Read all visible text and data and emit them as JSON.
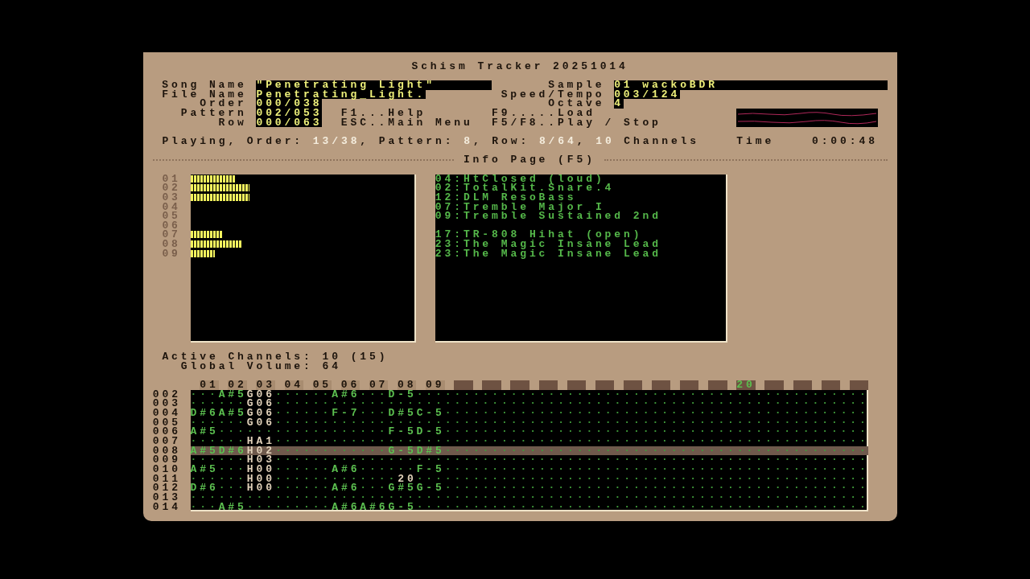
{
  "title": "Schism Tracker 20251014",
  "song_fields": [
    {
      "label": "Song Name",
      "value": "\"Penetrating Light\""
    },
    {
      "label": "File Name",
      "value": "Penetrating_Light."
    },
    {
      "label": "Order",
      "value": "000/038"
    },
    {
      "label": "Pattern",
      "value": "002/053"
    },
    {
      "label": "Row",
      "value": "000/063"
    }
  ],
  "shortcuts": [
    {
      "text": "F1...Help"
    },
    {
      "text": "ESC..Main Menu"
    },
    {
      "text": "F9.....Load"
    },
    {
      "text": "F5/F8..Play / Stop"
    }
  ],
  "sample_fields": [
    {
      "label": "Sample",
      "value": "01 wackoBDR"
    },
    {
      "label": "Speed/Tempo",
      "value": "003/124"
    },
    {
      "label": "Octave",
      "value": "4"
    }
  ],
  "status": [
    {
      "text": "Playing, Order: ",
      "kind": "label"
    },
    {
      "text": "13/38",
      "kind": "value"
    },
    {
      "text": ", Pattern: ",
      "kind": "label"
    },
    {
      "text": "8",
      "kind": "value"
    },
    {
      "text": ", Row: ",
      "kind": "label"
    },
    {
      "text": "8/64",
      "kind": "value"
    },
    {
      "text": ", ",
      "kind": "label"
    },
    {
      "text": "10",
      "kind": "value"
    },
    {
      "text": " Channels",
      "kind": "label"
    }
  ],
  "time": {
    "label": "Time",
    "value": "0:00:48"
  },
  "page_title": "Info Page (F5)",
  "channels": [
    {
      "number": "01",
      "level": 0.2,
      "instrument": "04:HtClosed (loud)"
    },
    {
      "number": "02",
      "level": 0.26,
      "instrument": "02:TotalKit.Snare.4"
    },
    {
      "number": "03",
      "level": 0.26,
      "instrument": "12:DLM ResoBass"
    },
    {
      "number": "04",
      "level": 0,
      "instrument": "07:Tremble Major I"
    },
    {
      "number": "05",
      "level": 0,
      "instrument": "09:Tremble Sustained 2nd"
    },
    {
      "number": "06",
      "level": 0
    },
    {
      "number": "07",
      "level": 0.14,
      "instrument": "17:TR-808 Hihat (open)"
    },
    {
      "number": "08",
      "level": 0.23,
      "instrument": "23:The Magic Insane Lead"
    },
    {
      "number": "09",
      "level": 0.11,
      "instrument": "23:The Magic Insane Lead"
    }
  ],
  "active_channels": "Active Channels: 10 (15)",
  "global_volume": "Global Volume: 64",
  "pattern": {
    "headers": [
      {
        "label": "01",
        "kind": "plain"
      },
      {
        "label": "02",
        "kind": "plain"
      },
      {
        "label": "03",
        "kind": "plain"
      },
      {
        "label": "04",
        "kind": "plain"
      },
      {
        "label": "05",
        "kind": "plain"
      },
      {
        "label": "06",
        "kind": "plain"
      },
      {
        "label": "07",
        "kind": "plain"
      },
      {
        "label": "08",
        "kind": "plain"
      },
      {
        "label": "09",
        "kind": "plain"
      },
      {
        "kind": "blank"
      },
      {
        "kind": "blank"
      },
      {
        "kind": "blank"
      },
      {
        "kind": "blank"
      },
      {
        "kind": "blank"
      },
      {
        "kind": "blank"
      },
      {
        "kind": "blank"
      },
      {
        "kind": "blank"
      },
      {
        "kind": "blank"
      },
      {
        "kind": "blank"
      },
      {
        "label": "20",
        "kind": "active"
      },
      {
        "kind": "blank"
      },
      {
        "kind": "blank"
      },
      {
        "kind": "blank"
      },
      {
        "kind": "blank"
      }
    ],
    "rows": [
      {
        "number": "002",
        "highlighted": false,
        "segments": [
          {
            "text": "···",
            "kind": "dots"
          },
          {
            "text": "A#5",
            "kind": "note"
          },
          {
            "text": "G06",
            "kind": "effect"
          },
          {
            "text": "······",
            "kind": "dots"
          },
          {
            "text": "A#6",
            "kind": "note"
          },
          {
            "text": "···",
            "kind": "dots"
          },
          {
            "text": "D-5",
            "kind": "note"
          },
          {
            "text": "················································",
            "kind": "dots"
          }
        ]
      },
      {
        "number": "003",
        "highlighted": false,
        "segments": [
          {
            "text": "······",
            "kind": "dots"
          },
          {
            "text": "G06",
            "kind": "effect"
          },
          {
            "text": "·········",
            "kind": "dots"
          },
          {
            "text": "·········",
            "kind": "dots"
          },
          {
            "text": "·········",
            "kind": "dots"
          },
          {
            "text": "·········",
            "kind": "dots"
          },
          {
            "text": "·········",
            "kind": "dots"
          },
          {
            "text": "·········",
            "kind": "dots"
          },
          {
            "text": "·········",
            "kind": "dots"
          }
        ]
      },
      {
        "number": "004",
        "highlighted": false,
        "segments": [
          {
            "text": "D#6",
            "kind": "note"
          },
          {
            "text": "A#5",
            "kind": "note"
          },
          {
            "text": "G06",
            "kind": "effect"
          },
          {
            "text": "······",
            "kind": "dots"
          },
          {
            "text": "F-7",
            "kind": "note"
          },
          {
            "text": "···",
            "kind": "dots"
          },
          {
            "text": "D#5",
            "kind": "note"
          },
          {
            "text": "C-5",
            "kind": "note"
          },
          {
            "text": "·············································",
            "kind": "dots"
          }
        ]
      },
      {
        "number": "005",
        "highlighted": false,
        "segments": [
          {
            "text": "······",
            "kind": "dots"
          },
          {
            "text": "G06",
            "kind": "effect"
          },
          {
            "text": "·········",
            "kind": "dots"
          },
          {
            "text": "·········",
            "kind": "dots"
          },
          {
            "text": "·········",
            "kind": "dots"
          },
          {
            "text": "·········",
            "kind": "dots"
          },
          {
            "text": "·········",
            "kind": "dots"
          },
          {
            "text": "·········",
            "kind": "dots"
          },
          {
            "text": "·········",
            "kind": "dots"
          }
        ]
      },
      {
        "number": "006",
        "highlighted": false,
        "segments": [
          {
            "text": "A#5",
            "kind": "note"
          },
          {
            "text": "··················",
            "kind": "dots"
          },
          {
            "text": "F-5",
            "kind": "note"
          },
          {
            "text": "D-5",
            "kind": "note"
          },
          {
            "text": "·············································",
            "kind": "dots"
          }
        ]
      },
      {
        "number": "007",
        "highlighted": false,
        "segments": [
          {
            "text": "······",
            "kind": "dots"
          },
          {
            "text": "HA1",
            "kind": "effect"
          },
          {
            "text": "·········",
            "kind": "dots"
          },
          {
            "text": "·········",
            "kind": "dots"
          },
          {
            "text": "·········",
            "kind": "dots"
          },
          {
            "text": "·········",
            "kind": "dots"
          },
          {
            "text": "·········",
            "kind": "dots"
          },
          {
            "text": "·········",
            "kind": "dots"
          },
          {
            "text": "·········",
            "kind": "dots"
          }
        ]
      },
      {
        "number": "008",
        "highlighted": true,
        "segments": [
          {
            "text": "A#5",
            "kind": "note"
          },
          {
            "text": "D#6",
            "kind": "note"
          },
          {
            "text": "H02",
            "kind": "effect"
          },
          {
            "text": "············",
            "kind": "dots"
          },
          {
            "text": "G-5",
            "kind": "note"
          },
          {
            "text": "D#5",
            "kind": "note"
          },
          {
            "text": "·············································",
            "kind": "dots"
          }
        ]
      },
      {
        "number": "009",
        "highlighted": false,
        "segments": [
          {
            "text": "······",
            "kind": "dots"
          },
          {
            "text": "H03",
            "kind": "effect"
          },
          {
            "text": "·········",
            "kind": "dots"
          },
          {
            "text": "·········",
            "kind": "dots"
          },
          {
            "text": "·········",
            "kind": "dots"
          },
          {
            "text": "·········",
            "kind": "dots"
          },
          {
            "text": "·········",
            "kind": "dots"
          },
          {
            "text": "·········",
            "kind": "dots"
          },
          {
            "text": "·········",
            "kind": "dots"
          }
        ]
      },
      {
        "number": "010",
        "highlighted": false,
        "segments": [
          {
            "text": "A#5",
            "kind": "note"
          },
          {
            "text": "···",
            "kind": "dots"
          },
          {
            "text": "H00",
            "kind": "effect"
          },
          {
            "text": "······",
            "kind": "dots"
          },
          {
            "text": "A#6",
            "kind": "note"
          },
          {
            "text": "······",
            "kind": "dots"
          },
          {
            "text": "F-5",
            "kind": "note"
          },
          {
            "text": "·············································",
            "kind": "dots"
          }
        ]
      },
      {
        "number": "011",
        "highlighted": false,
        "segments": [
          {
            "text": "······",
            "kind": "dots"
          },
          {
            "text": "H00",
            "kind": "effect"
          },
          {
            "text": "·············",
            "kind": "dots"
          },
          {
            "text": "20",
            "kind": "effect"
          },
          {
            "text": "················································",
            "kind": "dots"
          }
        ]
      },
      {
        "number": "012",
        "highlighted": false,
        "segments": [
          {
            "text": "D#6",
            "kind": "note"
          },
          {
            "text": "···",
            "kind": "dots"
          },
          {
            "text": "H00",
            "kind": "effect"
          },
          {
            "text": "······",
            "kind": "dots"
          },
          {
            "text": "A#6",
            "kind": "note"
          },
          {
            "text": "···",
            "kind": "dots"
          },
          {
            "text": "G#5",
            "kind": "note"
          },
          {
            "text": "G-5",
            "kind": "note"
          },
          {
            "text": "·············································",
            "kind": "dots"
          }
        ]
      },
      {
        "number": "013",
        "highlighted": false,
        "segments": [
          {
            "text": "·········",
            "kind": "dots"
          },
          {
            "text": "·········",
            "kind": "dots"
          },
          {
            "text": "·········",
            "kind": "dots"
          },
          {
            "text": "·········",
            "kind": "dots"
          },
          {
            "text": "·········",
            "kind": "dots"
          },
          {
            "text": "·········",
            "kind": "dots"
          },
          {
            "text": "·········",
            "kind": "dots"
          },
          {
            "text": "·········",
            "kind": "dots"
          }
        ]
      },
      {
        "number": "014",
        "highlighted": false,
        "segments": [
          {
            "text": "···",
            "kind": "dots"
          },
          {
            "text": "A#5",
            "kind": "note"
          },
          {
            "text": "·········",
            "kind": "dots"
          },
          {
            "text": "A#6",
            "kind": "note"
          },
          {
            "text": "A#6",
            "kind": "note"
          },
          {
            "text": "G-5",
            "kind": "note"
          },
          {
            "text": "················································",
            "kind": "dots"
          }
        ]
      }
    ]
  }
}
